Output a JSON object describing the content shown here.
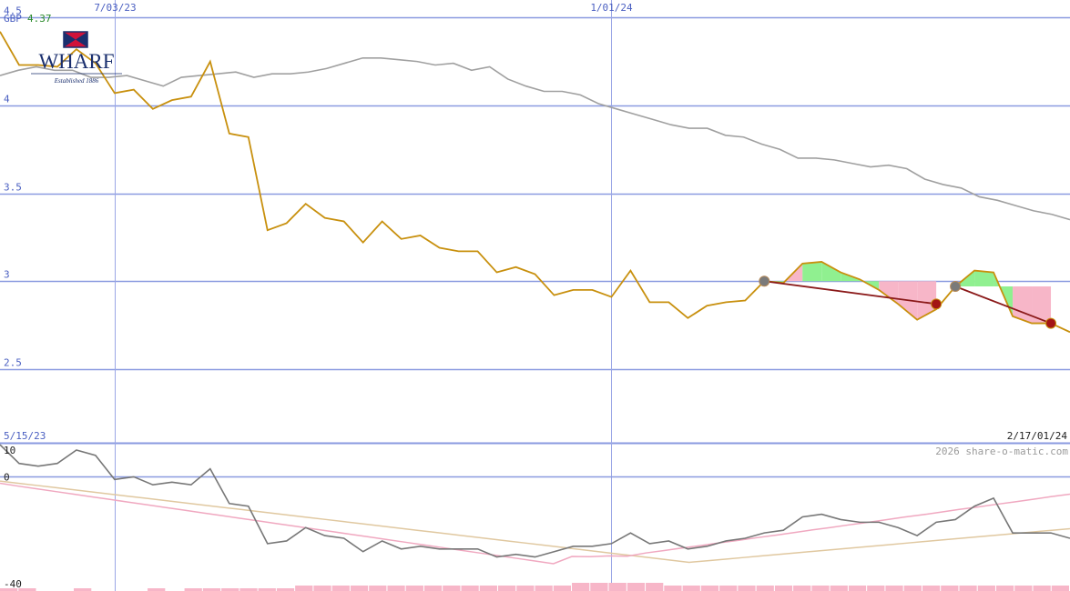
{
  "header": {
    "currency": "GBP",
    "last_price": "4.37"
  },
  "logo": {
    "name": "WHARF",
    "tagline": "Established 1886"
  },
  "watermark": "2026 share-o-matic.com",
  "chart_data": [
    {
      "type": "line",
      "title": "",
      "x_start_label": "5/15/23",
      "x_end_label": "2/17/01/24",
      "x_tick_labels": [
        {
          "label": "7/03/23",
          "index": 6
        },
        {
          "label": "1/01/24",
          "index": 32
        }
      ],
      "ylim": [
        2.08,
        4.6
      ],
      "y_ticks": [
        2.5,
        3,
        3.5,
        4,
        4.5
      ],
      "grid": true,
      "colors": {
        "price": "#c8900e",
        "moving_average": "#a0a0a0",
        "grid": "#8a9ae0",
        "gain_fill": "#90f090",
        "loss_fill": "#f7b6c8",
        "trend_line": "#8b1a1a"
      },
      "series": [
        {
          "role": "price",
          "values": [
            4.42,
            4.23,
            4.23,
            4.22,
            4.32,
            4.24,
            4.07,
            4.09,
            3.98,
            4.03,
            4.05,
            4.25,
            3.84,
            3.82,
            3.29,
            3.33,
            3.44,
            3.36,
            3.34,
            3.22,
            3.34,
            3.24,
            3.26,
            3.19,
            3.17,
            3.17,
            3.05,
            3.08,
            3.04,
            2.92,
            2.95,
            2.95,
            2.91,
            3.06,
            2.88,
            2.88,
            2.79,
            2.86,
            2.88,
            2.89,
            3.0,
            2.99,
            3.1,
            3.11,
            3.05,
            3.01,
            2.95,
            2.87,
            2.78,
            2.84,
            2.97,
            3.06,
            3.05,
            2.8,
            2.76,
            2.76,
            2.71
          ]
        },
        {
          "role": "moving_average",
          "values": [
            4.17,
            4.2,
            4.22,
            4.2,
            4.2,
            4.16,
            4.16,
            4.17,
            4.14,
            4.11,
            4.16,
            4.17,
            4.18,
            4.19,
            4.16,
            4.18,
            4.18,
            4.19,
            4.21,
            4.24,
            4.27,
            4.27,
            4.26,
            4.25,
            4.23,
            4.24,
            4.2,
            4.22,
            4.15,
            4.11,
            4.08,
            4.08,
            4.06,
            4.01,
            3.98,
            3.95,
            3.92,
            3.89,
            3.87,
            3.87,
            3.83,
            3.82,
            3.78,
            3.75,
            3.7,
            3.7,
            3.69,
            3.67,
            3.65,
            3.66,
            3.64,
            3.58,
            3.55,
            3.53,
            3.48,
            3.46,
            3.43,
            3.4,
            3.38,
            3.35
          ]
        }
      ],
      "signals": [
        {
          "from_index": 40,
          "to_index": 49,
          "from_value": 3.0,
          "to_value": 2.87
        },
        {
          "from_index": 50,
          "to_index": 55,
          "from_value": 2.97,
          "to_value": 2.76
        }
      ]
    },
    {
      "type": "line",
      "title": "",
      "ylim": [
        -40,
        10
      ],
      "y_ticks": [
        10,
        0,
        -40
      ],
      "colors": {
        "oscillator": "#777777",
        "fast_average": "#f0a8c0",
        "slow_average": "#e0c8a0",
        "histogram": "#f7b6c8",
        "zero_line": "#8a9ae0"
      },
      "series": [
        {
          "role": "oscillator",
          "values": [
            12,
            5,
            4,
            5,
            10,
            8,
            -1,
            0,
            -3,
            -2,
            -3,
            3,
            -10,
            -11,
            -25,
            -24,
            -19,
            -22,
            -23,
            -28,
            -24,
            -27,
            -26,
            -27,
            -27,
            -27,
            -30,
            -29,
            -30,
            -28,
            -26,
            -26,
            -25,
            -21,
            -25,
            -24,
            -27,
            -26,
            -24,
            -23,
            -21,
            -20,
            -15,
            -14,
            -16,
            -17,
            -17,
            -19,
            -22,
            -17,
            -16,
            -11,
            -8,
            -21,
            -21,
            -21,
            -23
          ]
        },
        {
          "role": "fast_average",
          "values": [
            -2.4,
            -3.5,
            -4.5,
            -5.5,
            -6.5,
            -7.5,
            -8.5,
            -9.5,
            -10.5,
            -11.5,
            -12.5,
            -13.5,
            -14.5,
            -15.5,
            -16.5,
            -17.5,
            -18.5,
            -19.5,
            -20.5,
            -21.5,
            -22.5,
            -23.5,
            -24.5,
            -25.5,
            -26.5,
            -27.5,
            -28.5,
            -29.5,
            -30.5,
            -31.5,
            -32.5,
            -29.8,
            -29.9,
            -29.6,
            -29.7,
            -28.5,
            -27.6,
            -26.6,
            -25.7,
            -24.7,
            -23.8,
            -22.8,
            -21.9,
            -20.9,
            -19.9,
            -19.0,
            -18.0,
            -17.1,
            -16.1,
            -15.1,
            -14.2,
            -13.2,
            -12.2,
            -11.3,
            -10.3,
            -9.4,
            -8.4,
            -7.4,
            -6.5
          ]
        },
        {
          "role": "slow_average",
          "values": [
            -1.6,
            -2.4,
            -3.2,
            -4.0,
            -4.8,
            -5.6,
            -6.4,
            -7.2,
            -8.0,
            -8.8,
            -9.6,
            -10.4,
            -11.2,
            -12.0,
            -12.8,
            -13.6,
            -14.4,
            -15.2,
            -16.0,
            -16.8,
            -17.6,
            -18.4,
            -19.2,
            -20.0,
            -20.8,
            -21.6,
            -22.4,
            -23.2,
            -24.0,
            -24.8,
            -25.6,
            -26.4,
            -27.2,
            -28.0,
            -28.8,
            -29.6,
            -30.4,
            -31.2,
            -32.0,
            -31.4,
            -30.8,
            -30.2,
            -29.6,
            -29.0,
            -28.4,
            -27.8,
            -27.2,
            -26.6,
            -26.0,
            -25.4,
            -24.8,
            -24.2,
            -23.6,
            -23.0,
            -22.4,
            -21.8,
            -21.2,
            -20.6,
            -20.0,
            -19.4
          ]
        }
      ],
      "histogram": [
        1,
        1,
        0,
        0,
        1,
        0,
        0,
        0,
        1,
        0,
        1,
        1,
        1,
        1,
        1,
        1,
        2,
        2,
        2,
        2,
        2,
        2,
        2,
        2,
        2,
        2,
        2,
        2,
        2,
        2,
        2,
        3,
        3,
        3,
        3,
        3,
        2,
        2,
        2,
        2,
        2,
        2,
        2,
        2,
        2,
        2,
        2,
        2,
        2,
        2,
        2,
        2,
        2,
        2,
        2,
        2,
        2,
        2
      ]
    }
  ]
}
